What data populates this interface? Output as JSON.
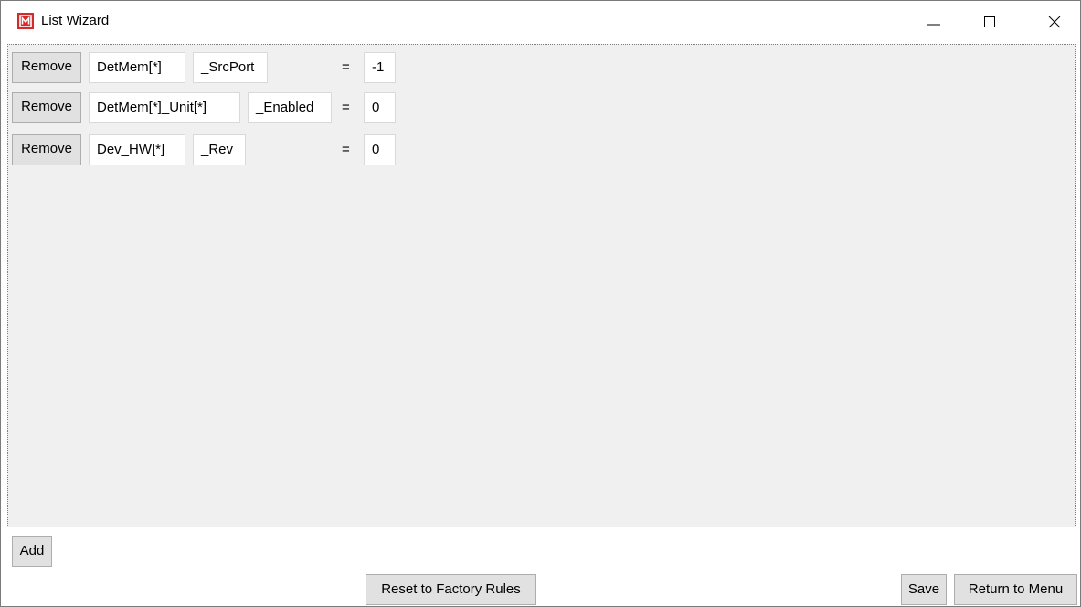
{
  "window": {
    "title": "List Wizard",
    "icon": "app-logo-icon",
    "controls": {
      "minimize": "minimize-icon",
      "maximize": "maximize-icon",
      "close": "close-icon"
    }
  },
  "rules": [
    {
      "remove_label": "Remove",
      "object": "DetMem[*]",
      "property": "_SrcPort",
      "operator": "=",
      "value": "-1"
    },
    {
      "remove_label": "Remove",
      "object": "DetMem[*]_Unit[*]",
      "property": "_Enabled",
      "operator": "=",
      "value": "0"
    },
    {
      "remove_label": "Remove",
      "object": "Dev_HW[*]",
      "property": "_Rev",
      "operator": "=",
      "value": "0"
    }
  ],
  "actions": {
    "add_label": "Add",
    "reset_label": "Reset to Factory Rules",
    "save_label": "Save",
    "return_label": "Return to Menu"
  },
  "colors": {
    "app_icon": "#d42a2a",
    "list_background": "#f0f0f0",
    "button_background": "#e1e1e1"
  }
}
